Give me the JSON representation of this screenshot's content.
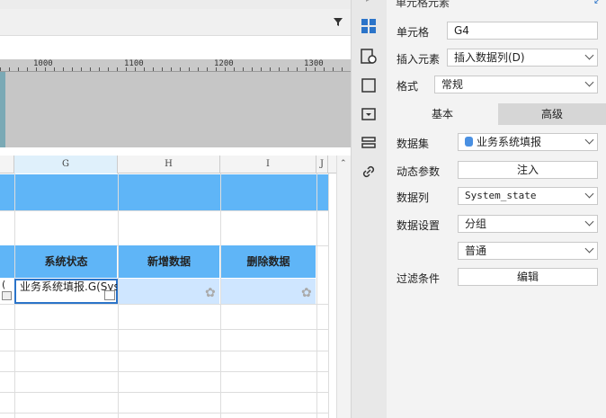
{
  "toolbar": {
    "filter_icon": "filter-icon"
  },
  "ruler": {
    "labels": [
      "1000",
      "1100",
      "1200",
      "1300"
    ]
  },
  "sheet": {
    "columns": [
      "G",
      "H",
      "I",
      "J"
    ],
    "header_row": [
      "系统状态",
      "新增数据",
      "删除数据"
    ],
    "selected_cell_text": "业务系统填报.G(System_state)",
    "partial_left_text": "("
  },
  "panel": {
    "title": "单元格元素",
    "cell_label": "单元格",
    "cell_value": "G4",
    "insert_label": "插入元素",
    "insert_value": "插入数据列(D)",
    "format_label": "格式",
    "format_value": "常规",
    "tabs": [
      "基本",
      "高级"
    ],
    "dataset_label": "数据集",
    "dataset_value": "业务系统填报",
    "param_label": "动态参数",
    "param_button": "注入",
    "column_label": "数据列",
    "column_value": "System_state",
    "setting_label": "数据设置",
    "setting_value": "分组",
    "setting_value2": "普通",
    "filter_label": "过滤条件",
    "filter_button": "编辑"
  },
  "colors": {
    "header_blue": "#5fb5f7",
    "selection": "#2b74c9",
    "data_row": "#cfe6ff"
  }
}
